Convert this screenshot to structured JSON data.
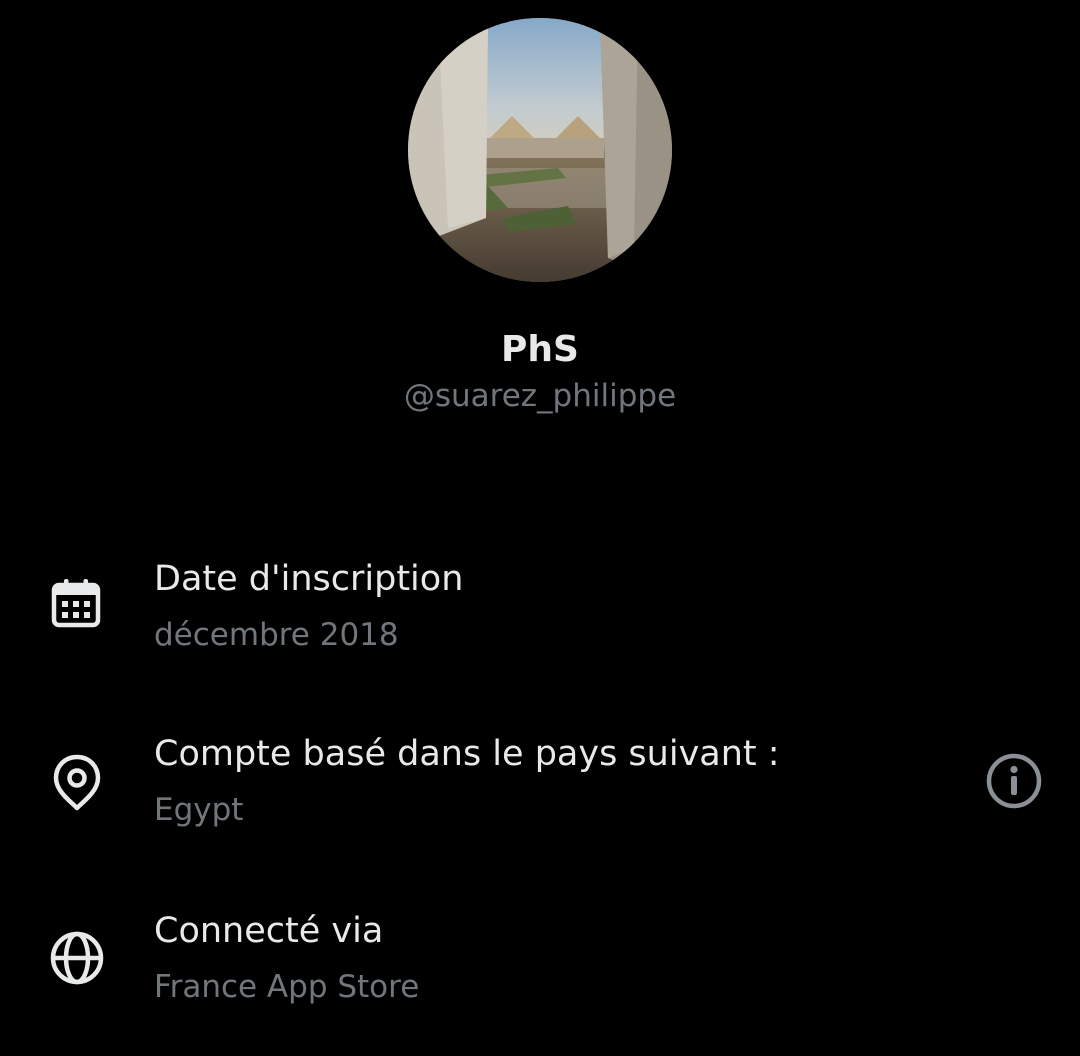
{
  "profile": {
    "display_name": "PhS",
    "handle": "@suarez_philippe",
    "avatar_icon": "profile-photo"
  },
  "about": {
    "items": [
      {
        "icon": "calendar-icon",
        "title": "Date d'inscription",
        "value": "décembre 2018"
      },
      {
        "icon": "location-pin-icon",
        "title": "Compte basé dans le pays suivant :",
        "value": "Egypt",
        "action_icon": "info-icon"
      },
      {
        "icon": "globe-icon",
        "title": "Connecté via",
        "value": "France App Store"
      }
    ]
  },
  "colors": {
    "background": "#000000",
    "primary_text": "#e7e9ea",
    "secondary_text": "#71767b"
  }
}
